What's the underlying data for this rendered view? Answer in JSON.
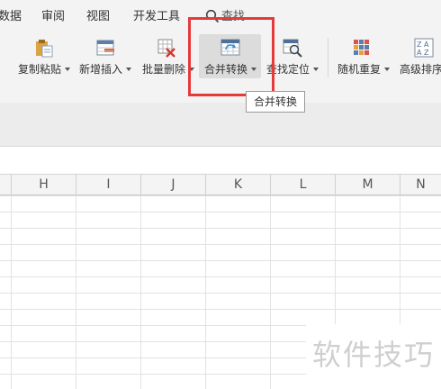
{
  "menu": {
    "tabs": [
      "数据",
      "审阅",
      "视图",
      "开发工具"
    ],
    "search_label": "查找"
  },
  "ribbon": {
    "buttons": [
      {
        "label": "复制粘贴",
        "icon": "clipboard-icon",
        "caret": true
      },
      {
        "label": "新增插入",
        "icon": "insert-row-icon",
        "caret": true
      },
      {
        "label": "批量删除",
        "icon": "delete-table-icon",
        "caret": true
      },
      {
        "label": "合并转换",
        "icon": "merge-convert-icon",
        "caret": true
      },
      {
        "label": "查找定位",
        "icon": "find-locate-icon",
        "caret": true
      },
      {
        "label": "随机重复",
        "icon": "random-repeat-icon",
        "caret": true
      },
      {
        "label": "高级排序",
        "icon": "sort-az-icon",
        "caret": false
      }
    ],
    "tooltip": "合并转换"
  },
  "sheet": {
    "columns": [
      "H",
      "I",
      "J",
      "K",
      "L",
      "M",
      "N"
    ]
  },
  "watermark": "软件技巧",
  "colors": {
    "highlight": "#e53a3a",
    "ribbon_bg": "#f3f3f3"
  }
}
